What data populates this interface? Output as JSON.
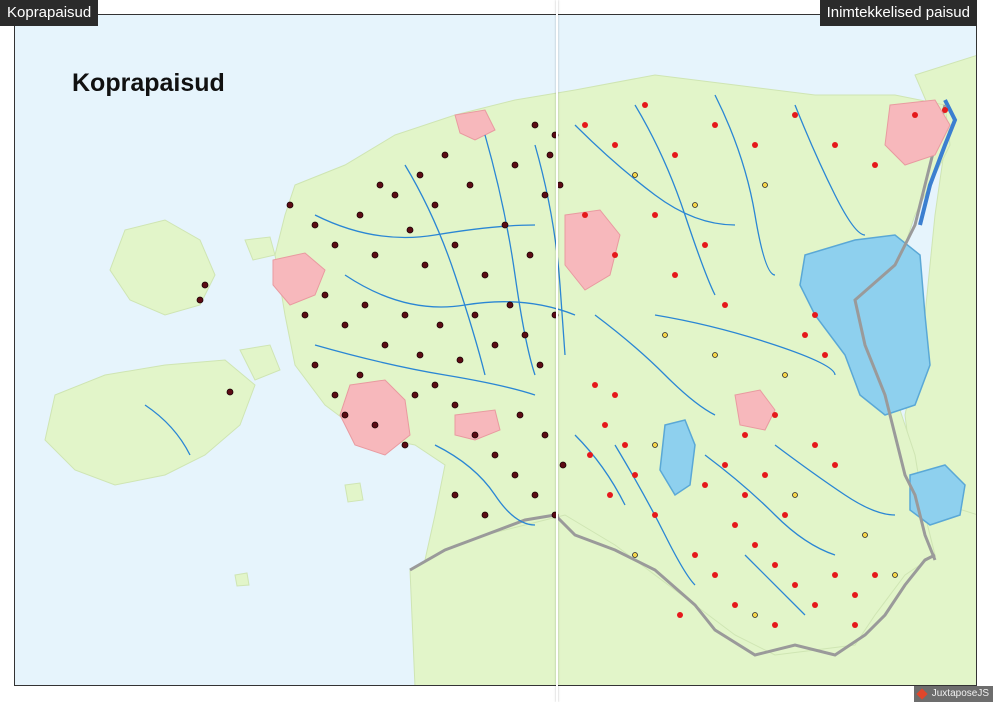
{
  "labels": {
    "left_panel": "Koprapaisud",
    "right_panel": "Inimtekkelised paisud"
  },
  "map": {
    "title": "Koprapaisud",
    "colors": {
      "sea": "#e6f4fc",
      "land": "#e2f5c9",
      "lake": "#8ed0ee",
      "river": "#2a86d4",
      "city": "#f7b8bc",
      "border": "#9a9a9a",
      "beaver_dam": "#5c0b14",
      "human_dam": "#e5191c"
    }
  },
  "credit": {
    "icon": "juxtapose-logo-icon",
    "text": "JuxtaposeJS"
  }
}
